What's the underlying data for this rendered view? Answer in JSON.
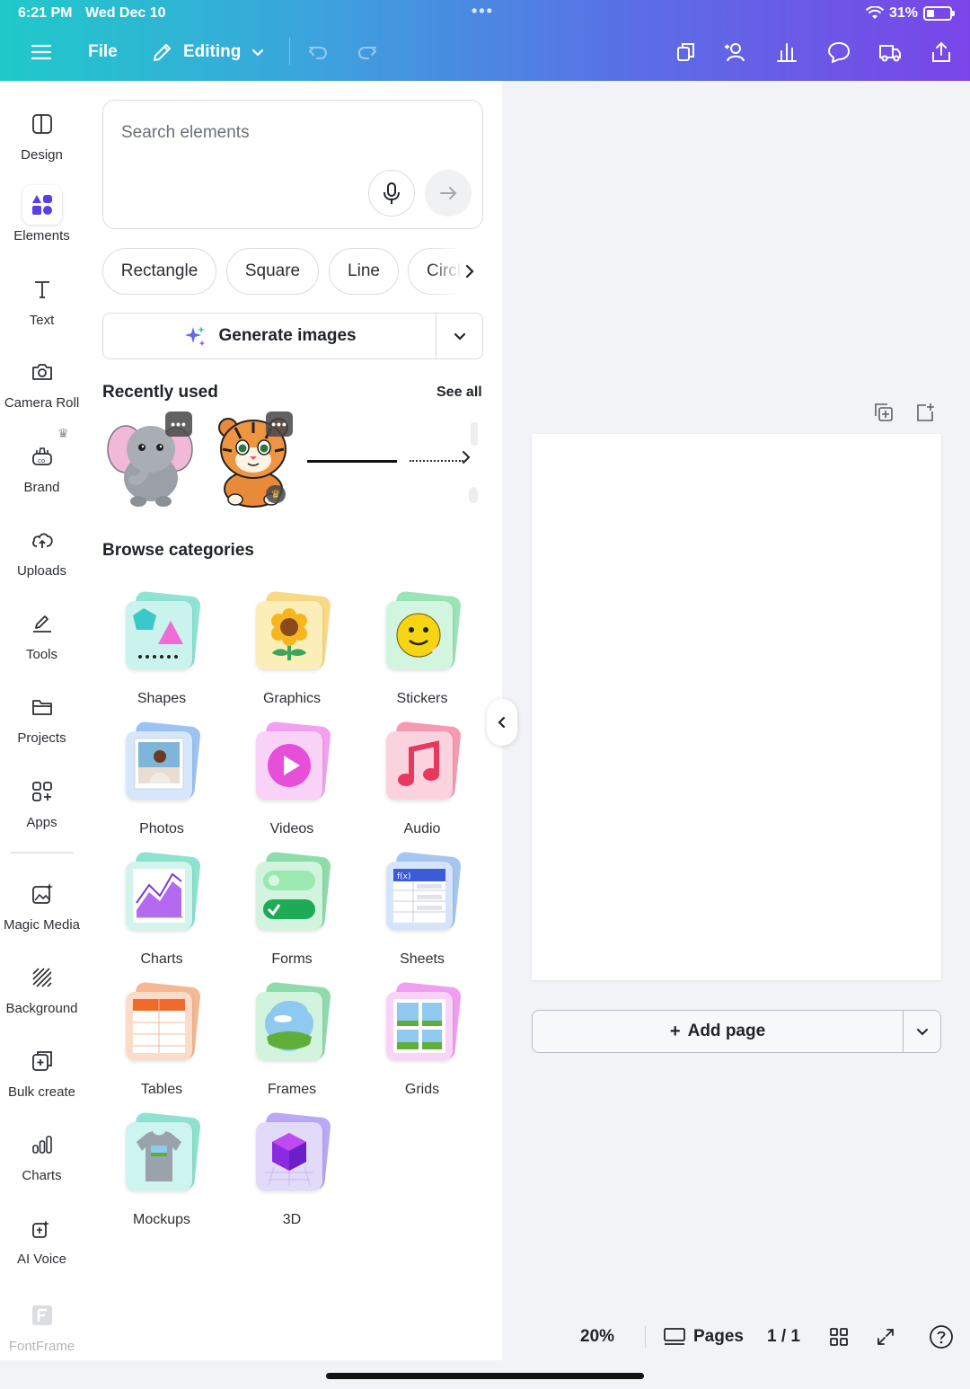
{
  "status_bar": {
    "time": "6:21 PM",
    "date": "Wed Dec 10",
    "battery": "31%",
    "battery_level": 0.31
  },
  "toolbar": {
    "file_label": "File",
    "mode_label": "Editing"
  },
  "rail": {
    "items": [
      {
        "label": "Design",
        "icon": "layout-icon"
      },
      {
        "label": "Elements",
        "icon": "shapes-icon"
      },
      {
        "label": "Text",
        "icon": "text-icon"
      },
      {
        "label": "Camera Roll",
        "icon": "camera-icon"
      },
      {
        "label": "Brand",
        "icon": "brand-icon"
      },
      {
        "label": "Uploads",
        "icon": "cloud-upload-icon"
      },
      {
        "label": "Tools",
        "icon": "pen-icon"
      },
      {
        "label": "Projects",
        "icon": "folder-icon"
      },
      {
        "label": "Apps",
        "icon": "apps-icon"
      },
      {
        "label": "Magic Media",
        "icon": "magic-media-icon"
      },
      {
        "label": "Background",
        "icon": "background-icon"
      },
      {
        "label": "Bulk create",
        "icon": "bulk-create-icon"
      },
      {
        "label": "Charts",
        "icon": "charts-icon"
      },
      {
        "label": "AI Voice",
        "icon": "ai-voice-icon"
      },
      {
        "label": "FontFrame",
        "icon": "fontframe-icon"
      }
    ],
    "active": "Elements"
  },
  "panel": {
    "search": {
      "placeholder": "Search elements",
      "value": ""
    },
    "chips": [
      "Rectangle",
      "Square",
      "Line",
      "Circle"
    ],
    "generate_label": "Generate images",
    "recently_used_title": "Recently used",
    "see_all_label": "See all",
    "browse_title": "Browse categories",
    "categories": [
      "Shapes",
      "Graphics",
      "Stickers",
      "Photos",
      "Videos",
      "Audio",
      "Charts",
      "Forms",
      "Sheets",
      "Tables",
      "Frames",
      "Grids",
      "Mockups",
      "3D"
    ]
  },
  "canvas": {
    "add_page_label": "Add page"
  },
  "bottom": {
    "zoom": "20%",
    "pages_label": "Pages",
    "page_count": "1 / 1"
  },
  "colors": {
    "accent": "#7d2ae8",
    "header_start": "#1fc9c9",
    "header_end": "#7a45e8"
  }
}
